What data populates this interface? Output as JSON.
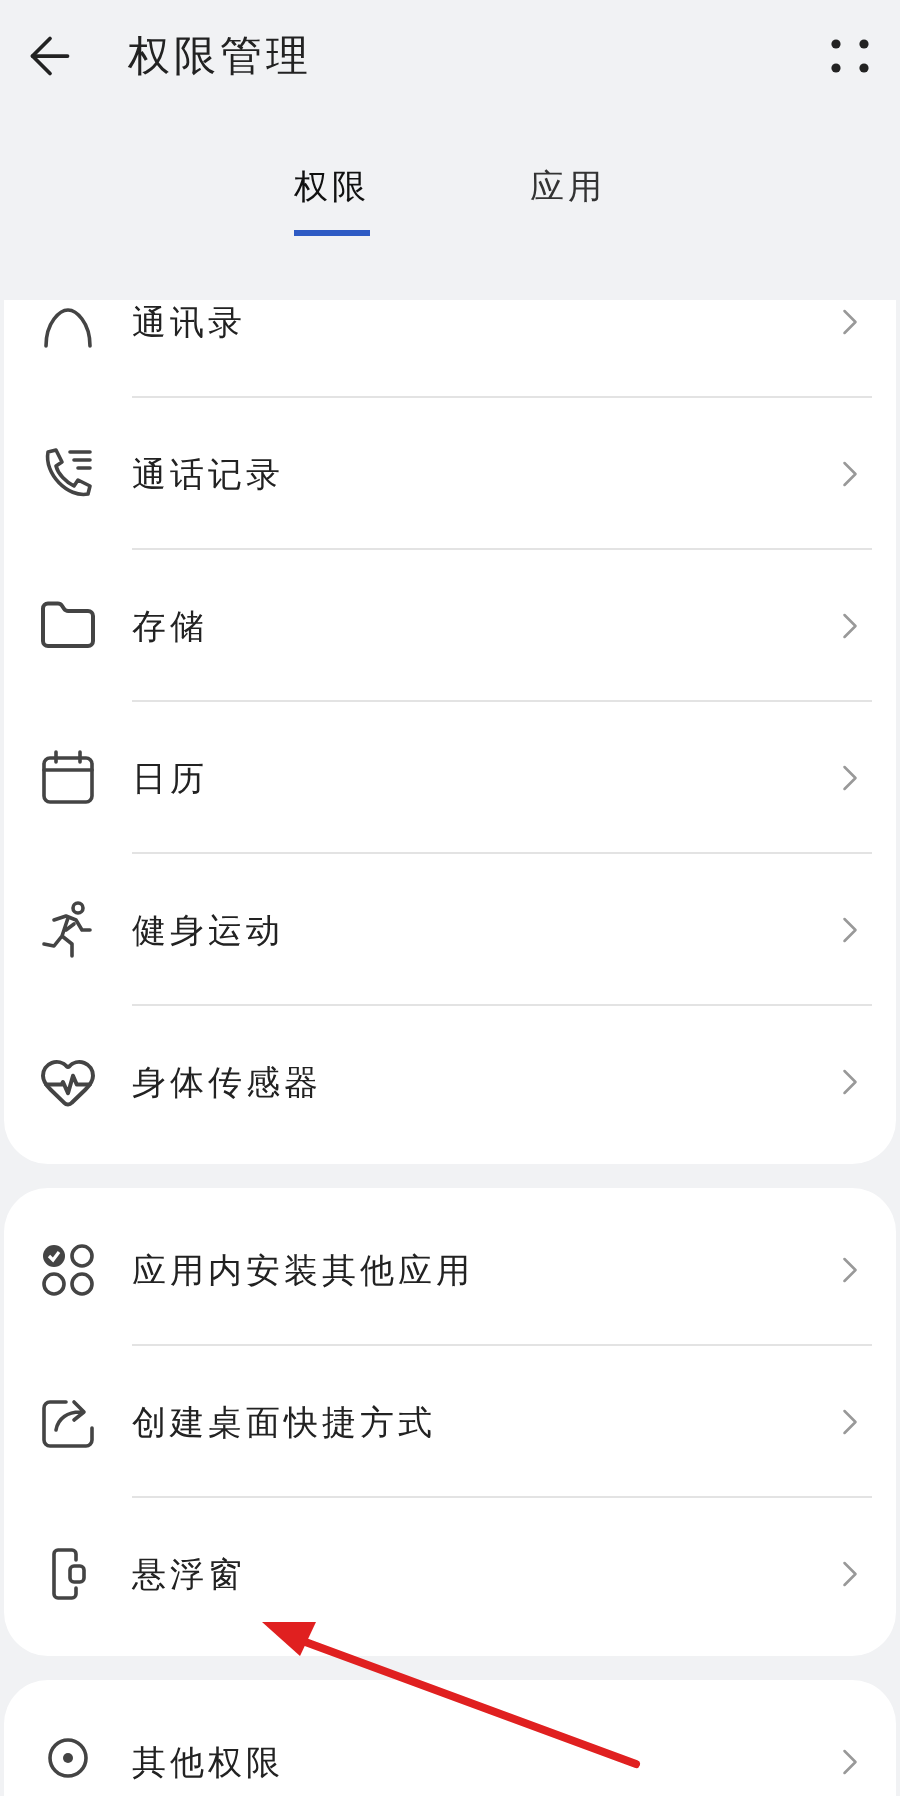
{
  "header": {
    "title": "权限管理"
  },
  "tabs": [
    {
      "label": "权限",
      "selected": true
    },
    {
      "label": "应用",
      "selected": false
    }
  ],
  "groups": [
    {
      "items": [
        {
          "label": "通讯录"
        },
        {
          "label": "通话记录"
        },
        {
          "label": "存储"
        },
        {
          "label": "日历"
        },
        {
          "label": "健身运动"
        },
        {
          "label": "身体传感器"
        }
      ]
    },
    {
      "items": [
        {
          "label": "应用内安装其他应用"
        },
        {
          "label": "创建桌面快捷方式"
        },
        {
          "label": "悬浮窗"
        }
      ]
    },
    {
      "items": [
        {
          "label": "其他权限"
        }
      ]
    }
  ]
}
